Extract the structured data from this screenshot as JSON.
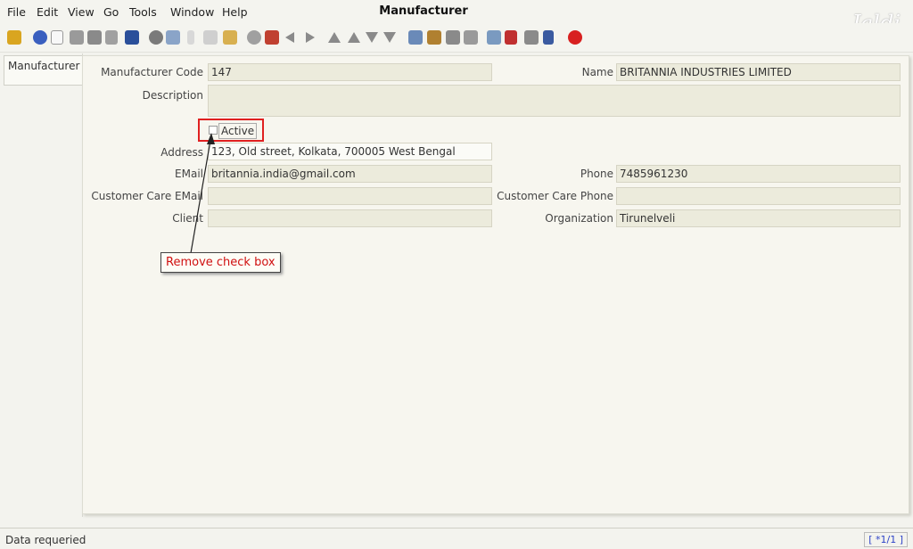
{
  "menu": {
    "file": "File",
    "edit": "Edit",
    "view": "View",
    "go": "Go",
    "tools": "Tools",
    "window": "Window",
    "help": "Help"
  },
  "window": {
    "title": "Manufacturer",
    "logo": "Jaldi"
  },
  "toolbar": {
    "icons": [
      "undo-icon",
      "help-icon",
      "new-icon",
      "copy-icon",
      "delete-icon",
      "delete-selection-icon",
      "save-icon",
      "refresh-icon",
      "find-icon",
      "attachment-icon",
      "chat-icon",
      "history-icon",
      "home-icon",
      "back-icon",
      "forward-icon",
      "first-record-icon",
      "previous-record-icon",
      "next-record-icon",
      "last-record-icon",
      "report-icon",
      "archive-icon",
      "print-preview-icon",
      "print-icon",
      "zoom-across-icon",
      "request-icon",
      "product-info-icon",
      "workflow-icon",
      "close-icon"
    ]
  },
  "sidebar": {
    "tab_label": "Manufacturer"
  },
  "form": {
    "manufacturer_code": {
      "label": "Manufacturer Code",
      "value": "147"
    },
    "name": {
      "label": "Name",
      "value": "BRITANNIA INDUSTRIES LIMITED"
    },
    "description": {
      "label": "Description",
      "value": ""
    },
    "active": {
      "label": "Active",
      "checked": false
    },
    "address": {
      "label": "Address",
      "value": "123, Old street, Kolkata,  700005 West Bengal"
    },
    "email": {
      "label": "EMail",
      "value": "britannia.india@gmail.com"
    },
    "phone": {
      "label": "Phone",
      "value": "7485961230"
    },
    "customer_care_email": {
      "label": "Customer Care EMail",
      "value": ""
    },
    "customer_care_phone": {
      "label": "Customer Care Phone",
      "value": ""
    },
    "client": {
      "label": "Client",
      "value": ""
    },
    "organization": {
      "label": "Organization",
      "value": "Tirunelveli"
    }
  },
  "annotation": {
    "text": "Remove check box",
    "color": "#e02020"
  },
  "status": {
    "message": "Data requeried",
    "record_nav": "[ *1/1 ]"
  }
}
